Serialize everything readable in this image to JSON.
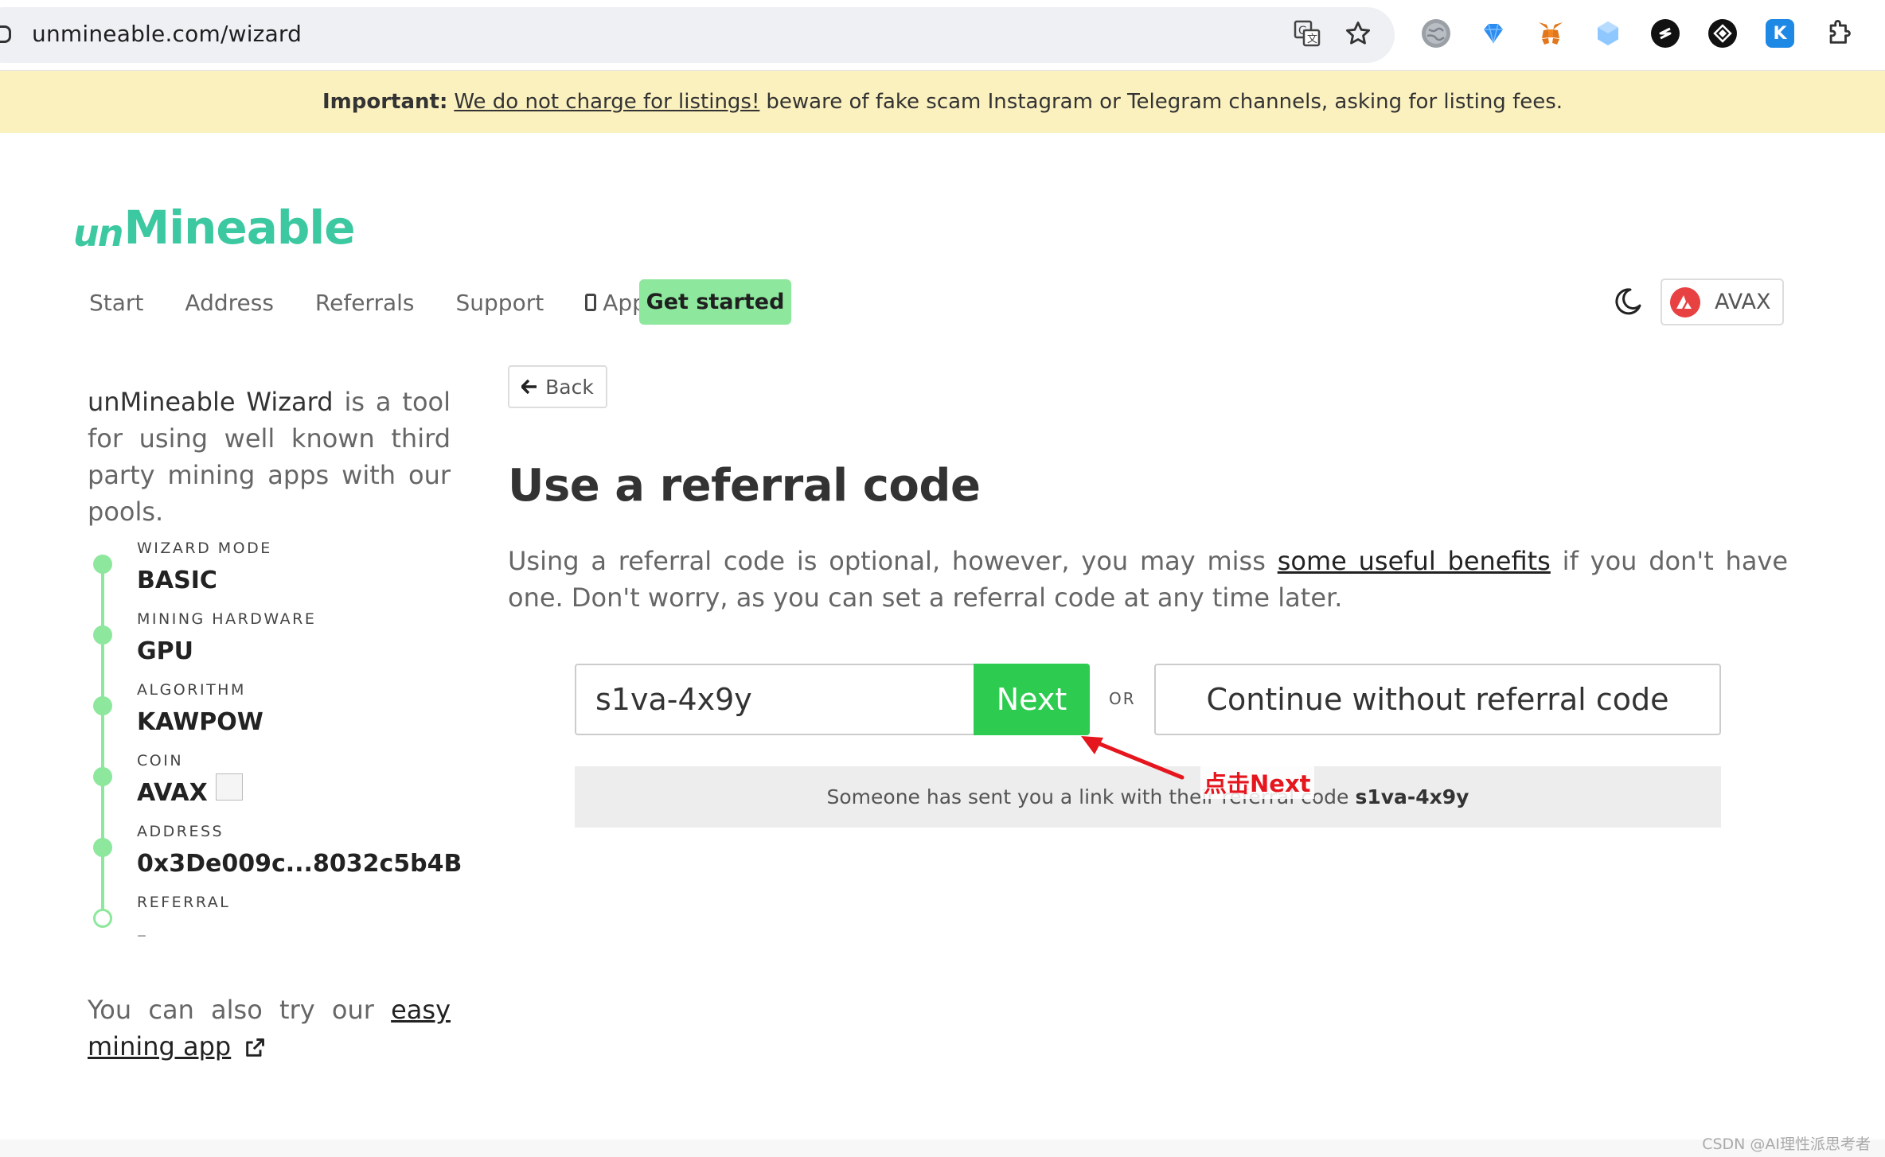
{
  "browser": {
    "url": "unmineable.com/wizard"
  },
  "banner": {
    "important_label": "Important:",
    "link_text": "We do not charge for listings!",
    "rest_text": "beware of fake scam Instagram or Telegram channels, asking for listing fees."
  },
  "header": {
    "logo_prefix": "un",
    "logo_text": "Mineable",
    "nav": [
      "Start",
      "Address",
      "Referrals",
      "Support",
      "App"
    ],
    "get_started": "Get started",
    "coin": "AVAX"
  },
  "sidebar": {
    "intro_name": "unMineable Wizard",
    "intro_rest": "is a tool for using well known third party mining apps with our pools.",
    "steps": [
      {
        "label": "WIZARD MODE",
        "value": "BASIC"
      },
      {
        "label": "MINING HARDWARE",
        "value": "GPU"
      },
      {
        "label": "ALGORITHM",
        "value": "KAWPOW"
      },
      {
        "label": "COIN",
        "value": "AVAX"
      },
      {
        "label": "ADDRESS",
        "value": "0x3De009c...8032c5b4B"
      },
      {
        "label": "REFERRAL",
        "value": "–"
      }
    ],
    "also_text": "You can also try our",
    "also_link": "easy mining app"
  },
  "main": {
    "back": "Back",
    "heading": "Use a referral code",
    "desc_start": "Using a referral code is optional, however, you may miss",
    "desc_link": "some useful benefits",
    "desc_end": "if you don't have one. Don't worry, as you can set a referral code at any time later.",
    "referral_value": "s1va-4x9y",
    "next": "Next",
    "or": "OR",
    "continue": "Continue without referral code",
    "notice_text": "Someone has sent you a link with their referral code",
    "notice_code": "s1va-4x9y"
  },
  "annotation": {
    "text": "点击Next",
    "color": "#e5161d"
  },
  "watermark": "CSDN @AI理性派思考者",
  "colors": {
    "brand": "#3cc8a0",
    "accent_green": "#2dcb4f",
    "light_green": "#8de79d",
    "banner_bg": "#fbf1bf"
  }
}
